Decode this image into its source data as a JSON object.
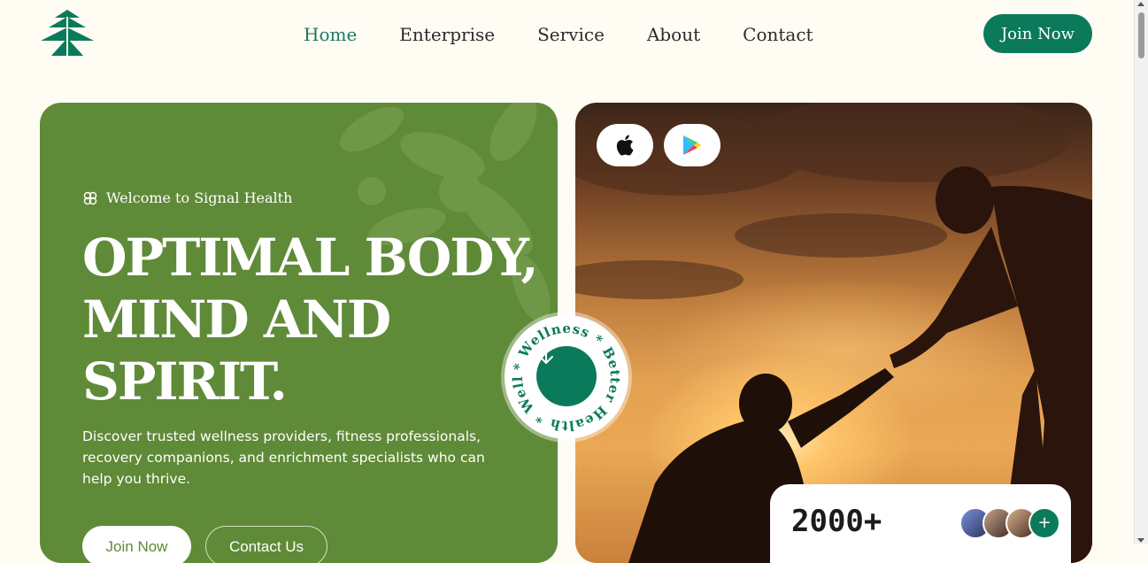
{
  "nav": {
    "items": [
      {
        "label": "Home",
        "active": true
      },
      {
        "label": "Enterprise",
        "active": false
      },
      {
        "label": "Service",
        "active": false
      },
      {
        "label": "About",
        "active": false
      },
      {
        "label": "Contact",
        "active": false
      }
    ],
    "join_label": "Join Now"
  },
  "logo": {
    "icon": "pine-tree-icon"
  },
  "hero": {
    "welcome": "Welcome to Signal Health",
    "headline": [
      "OPTIMAL BODY,",
      "MIND AND",
      "SPIRIT."
    ],
    "description": "Discover trusted wellness providers, fitness professionals, recovery companions, and enrichment specialists who can help you thrive.",
    "join_label": "Join Now",
    "contact_label": "Contact Us"
  },
  "badge": {
    "ring_text": "* Wellness * Better Health * Wellness",
    "icon": "arrow-down-icon"
  },
  "store": {
    "apple_icon": "apple-icon",
    "play_icon": "google-play-icon"
  },
  "stats": {
    "count": "2000+",
    "plus": "+"
  },
  "colors": {
    "brand_green": "#0b7a5b",
    "hero_green": "#5f8a37",
    "background": "#fffcf4"
  }
}
